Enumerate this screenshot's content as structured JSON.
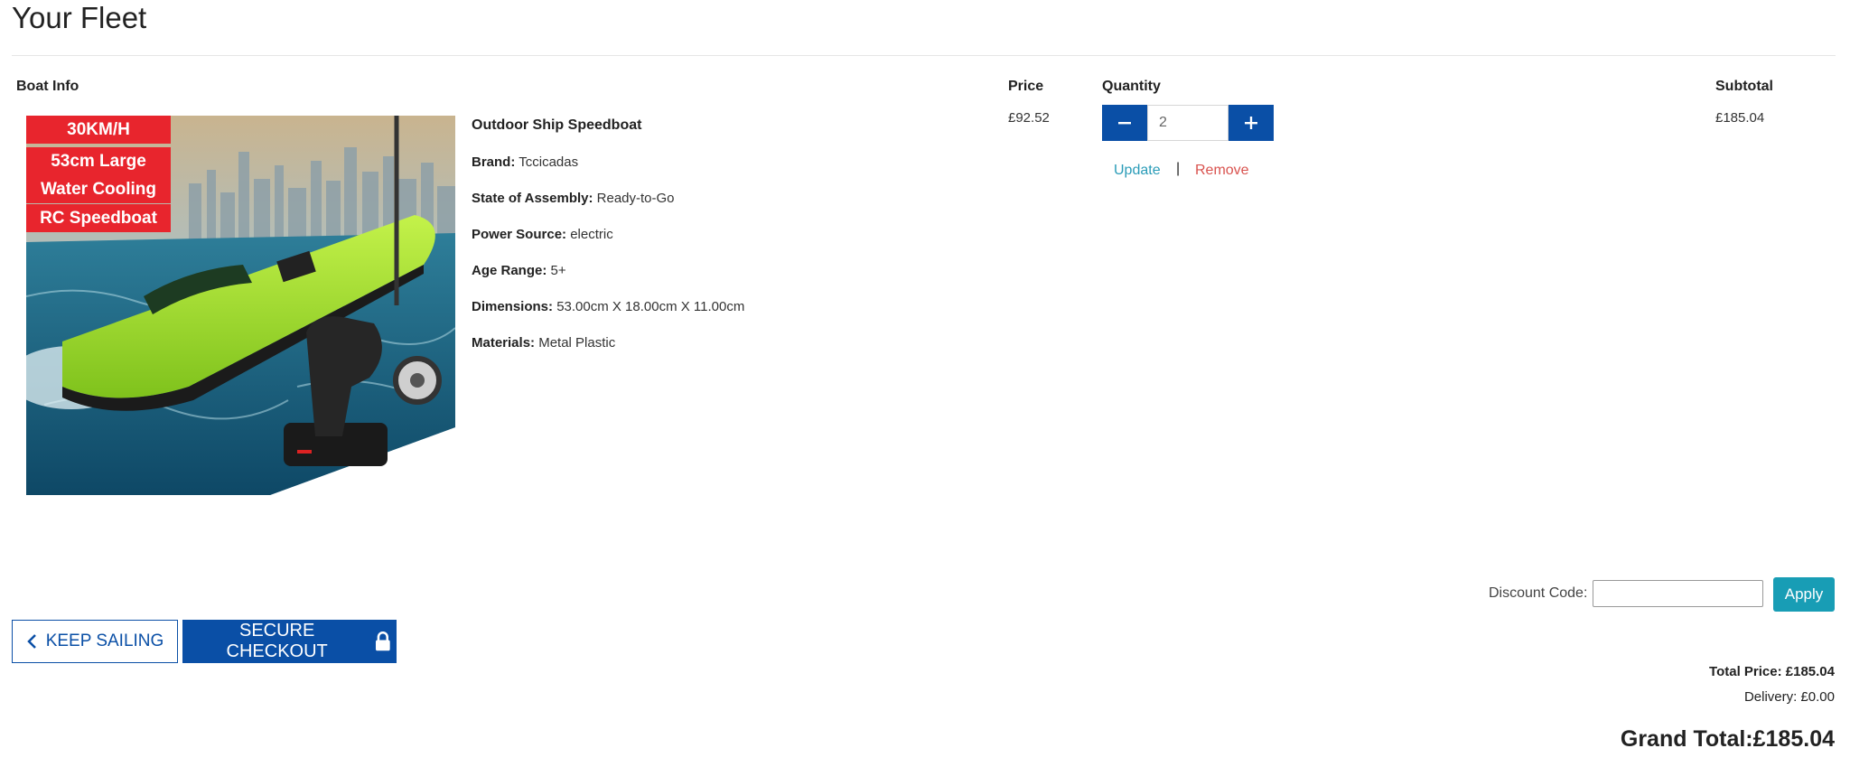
{
  "page": {
    "title": "Your Fleet"
  },
  "table": {
    "headers": {
      "boat_info": "Boat Info",
      "price": "Price",
      "quantity": "Quantity",
      "subtotal": "Subtotal"
    }
  },
  "item": {
    "badges": [
      "30KM/H",
      "53cm Large",
      "Water Cooling",
      "RC Speedboat"
    ],
    "name": "Outdoor Ship Speedboat",
    "attributes": [
      {
        "label": "Brand:",
        "value": "Tccicadas"
      },
      {
        "label": "State of Assembly:",
        "value": "Ready-to-Go"
      },
      {
        "label": "Power Source:",
        "value": "electric"
      },
      {
        "label": "Age Range:",
        "value": "5+"
      },
      {
        "label": "Dimensions:",
        "value": "53.00cm X 18.00cm X 11.00cm"
      },
      {
        "label": "Materials:",
        "value": "Metal Plastic"
      }
    ],
    "price": "£92.52",
    "quantity": "2",
    "minus_icon": "minus-icon",
    "plus_icon": "plus-icon",
    "update_label": "Update",
    "separator": "|",
    "remove_label": "Remove",
    "subtotal": "£185.04"
  },
  "discount": {
    "label": "Discount Code:",
    "value": "",
    "apply_label": "Apply"
  },
  "actions": {
    "keep_sailing_label": "KEEP SAILING",
    "keep_icon": "chevron-left-icon",
    "checkout_label": "SECURE CHECKOUT",
    "checkout_icon": "lock-icon"
  },
  "totals": {
    "total_price": "Total Price: £185.04",
    "delivery": "Delivery: £0.00",
    "grand_total": "Grand Total:£185.04"
  },
  "colors": {
    "primary": "#0a4fa6",
    "accent": "#189db5",
    "danger": "#d9534f",
    "badge": "#e8252d",
    "boat": "#a6e22e"
  }
}
